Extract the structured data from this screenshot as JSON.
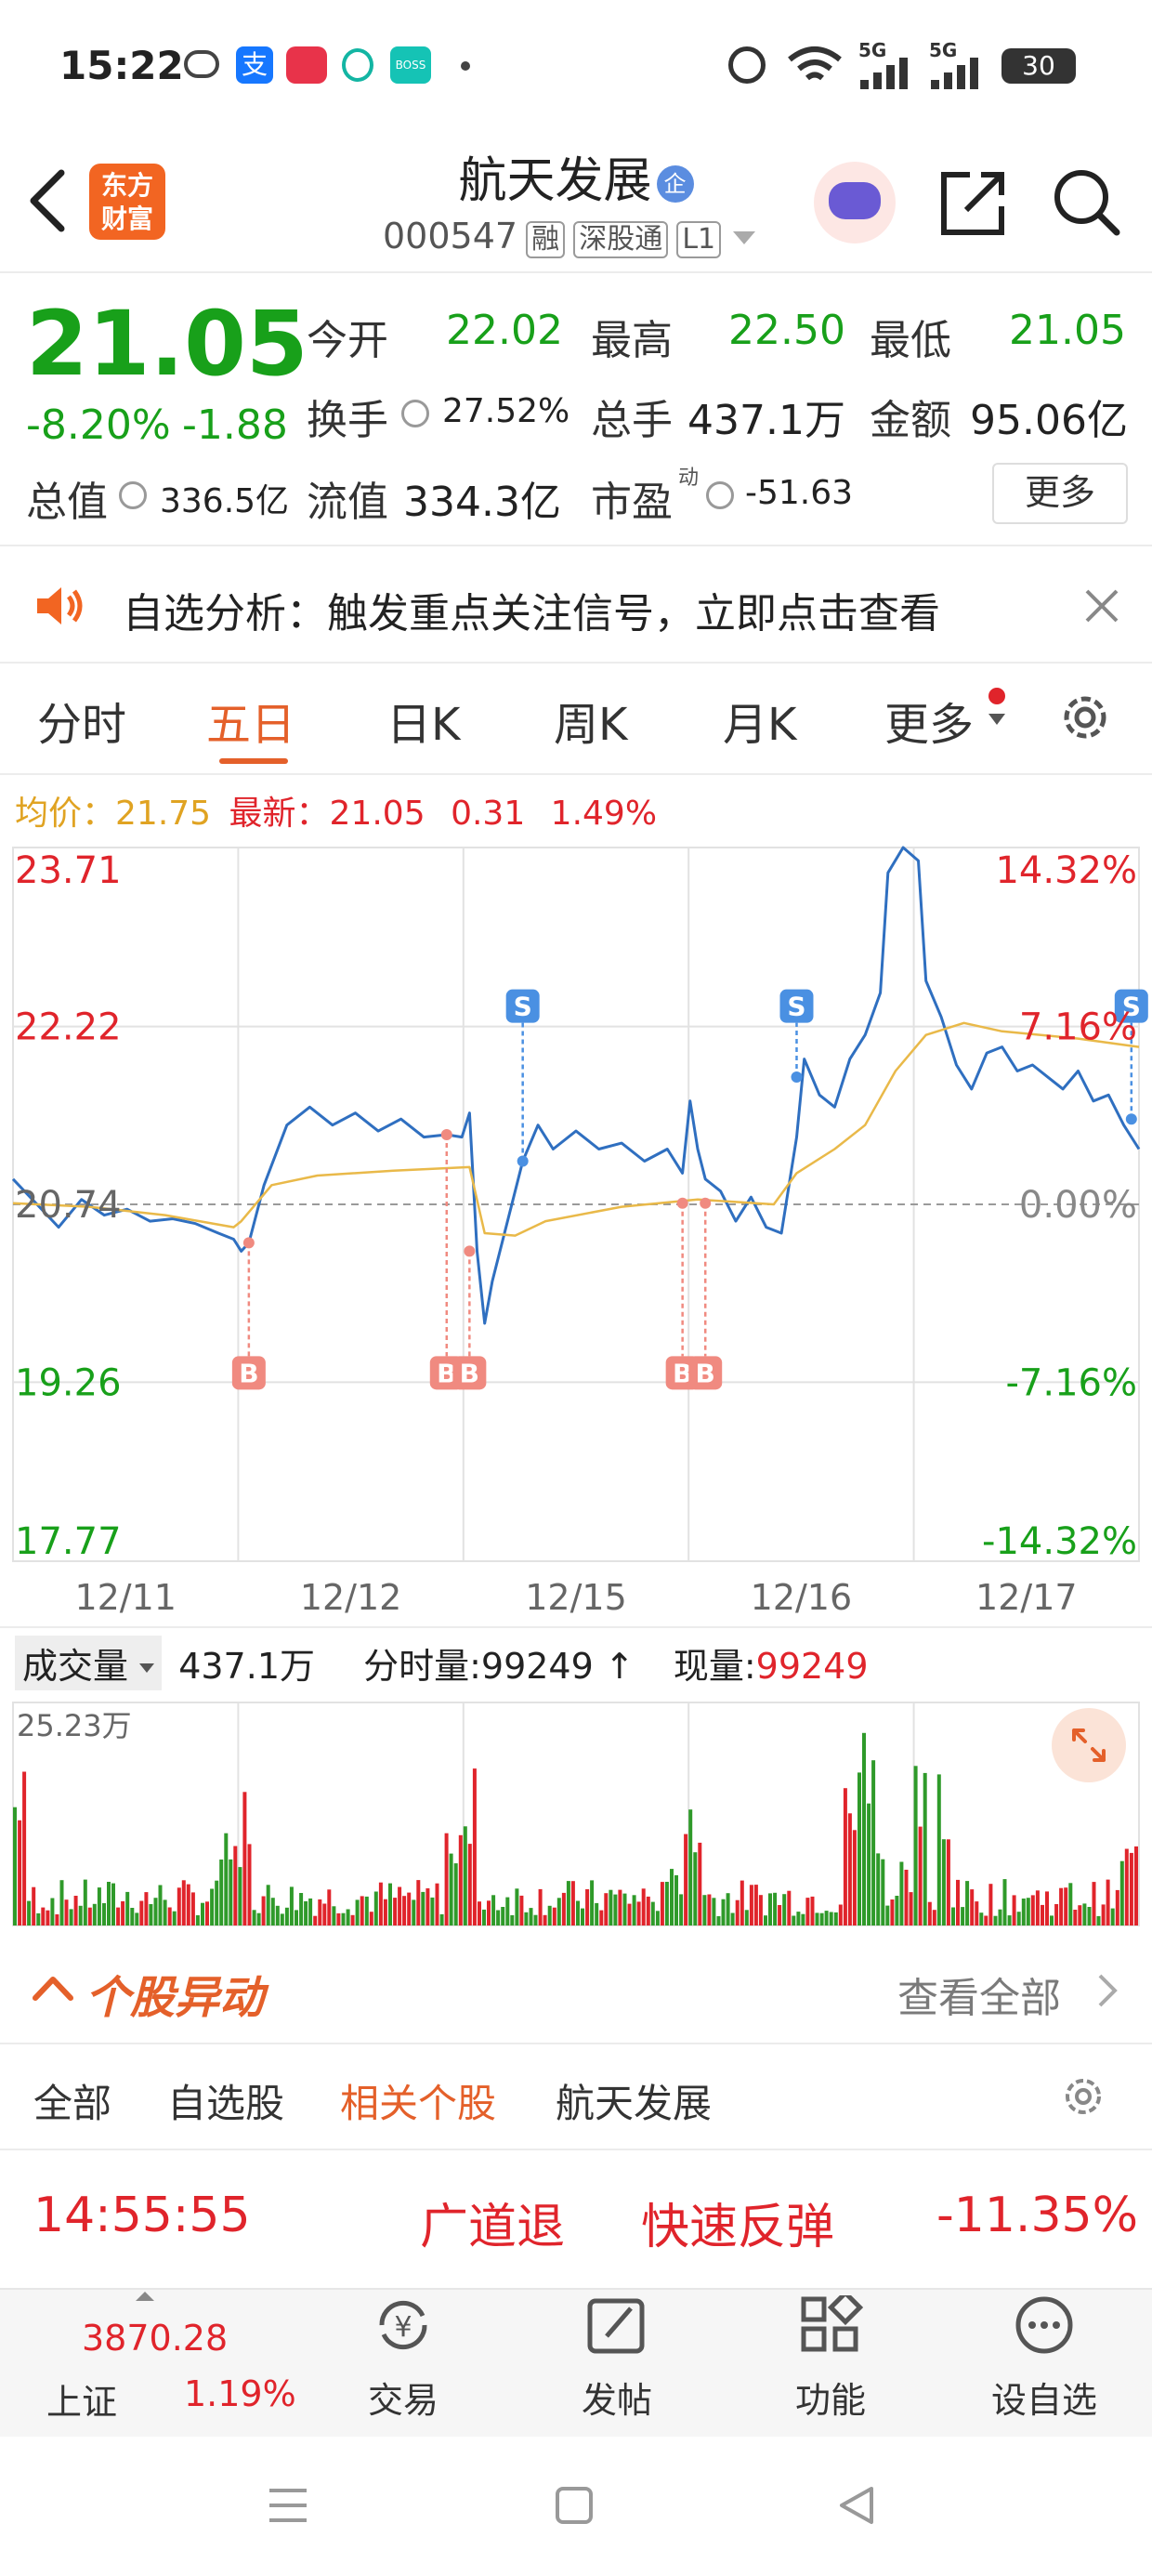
{
  "status_bar": {
    "time": "15:22",
    "battery": "30",
    "signal1": "5G",
    "signal2": "5G"
  },
  "header": {
    "logo_line1": "东方",
    "logo_line2": "财富",
    "stock_name": "航天发展",
    "badge": "企",
    "stock_code": "000547",
    "tags": [
      "融",
      "深股通",
      "L1"
    ]
  },
  "quote": {
    "price": "21.05",
    "change_pct": "-8.20%",
    "change": "-1.88",
    "stats": {
      "open_label": "今开",
      "open": "22.02",
      "high_label": "最高",
      "high": "22.50",
      "low_label": "最低",
      "low": "21.05",
      "turnover_label": "换手",
      "turnover": "27.52%",
      "volume_label": "总手",
      "volume": "437.1万",
      "amount_label": "金额",
      "amount": "95.06亿",
      "mktcap_label": "总值",
      "mktcap": "336.5亿",
      "float_label": "流值",
      "float": "334.3亿",
      "pe_label": "市盈",
      "pe_sup": "动",
      "pe": "-51.63"
    },
    "more_button": "更多"
  },
  "banner": {
    "text": "自选分析：触发重点关注信号，立即点击查看"
  },
  "tabs": {
    "items": [
      "分时",
      "五日",
      "日K",
      "周K",
      "月K",
      "更多"
    ],
    "active_index": 1
  },
  "chart_info": {
    "avg_label": "均价：",
    "avg_value": "21.75",
    "latest_label": "最新：",
    "latest_value": "21.05",
    "latest_change": "0.31",
    "latest_pct": "1.49%"
  },
  "chart_data": {
    "type": "line",
    "y_left_ticks": [
      "23.71",
      "22.22",
      "20.74",
      "19.26",
      "17.77"
    ],
    "y_right_ticks": [
      "14.32%",
      "7.16%",
      "0.00%",
      "-7.16%",
      "-14.32%"
    ],
    "x_labels": [
      "12/11",
      "12/12",
      "12/15",
      "12/16",
      "12/17"
    ],
    "ylim": [
      17.77,
      23.71
    ],
    "reference": 20.74,
    "series": [
      {
        "kind": "price",
        "color": "#2f6fc0",
        "points": [
          [
            0,
            20.95
          ],
          [
            3,
            20.75
          ],
          [
            6,
            20.55
          ],
          [
            9,
            20.78
          ],
          [
            12,
            20.65
          ],
          [
            15,
            20.7
          ],
          [
            18,
            20.6
          ],
          [
            21,
            20.62
          ],
          [
            24,
            20.58
          ],
          [
            27,
            20.5
          ],
          [
            29,
            20.45
          ],
          [
            30,
            20.35
          ],
          [
            31,
            20.42
          ],
          [
            33,
            20.9
          ],
          [
            36,
            21.4
          ],
          [
            39,
            21.55
          ],
          [
            42,
            21.4
          ],
          [
            45,
            21.5
          ],
          [
            48,
            21.35
          ],
          [
            51,
            21.45
          ],
          [
            54,
            21.3
          ],
          [
            57,
            21.32
          ],
          [
            59,
            21.3
          ],
          [
            60,
            21.5
          ],
          [
            61,
            20.35
          ],
          [
            62,
            19.75
          ],
          [
            63,
            20.1
          ],
          [
            65,
            20.6
          ],
          [
            67,
            21.1
          ],
          [
            69,
            21.4
          ],
          [
            71,
            21.2
          ],
          [
            74,
            21.35
          ],
          [
            77,
            21.2
          ],
          [
            80,
            21.25
          ],
          [
            83,
            21.1
          ],
          [
            86,
            21.2
          ],
          [
            88,
            21.0
          ],
          [
            89,
            21.6
          ],
          [
            90,
            21.2
          ],
          [
            91,
            20.95
          ],
          [
            93,
            20.85
          ],
          [
            95,
            20.6
          ],
          [
            97,
            20.8
          ],
          [
            99,
            20.55
          ],
          [
            101,
            20.5
          ],
          [
            103,
            21.3
          ],
          [
            104,
            21.95
          ],
          [
            106,
            21.65
          ],
          [
            108,
            21.55
          ],
          [
            110,
            21.95
          ],
          [
            112,
            22.15
          ],
          [
            114,
            22.5
          ],
          [
            115,
            23.5
          ],
          [
            117,
            23.71
          ],
          [
            119,
            23.6
          ],
          [
            120,
            22.6
          ],
          [
            122,
            22.3
          ],
          [
            124,
            21.9
          ],
          [
            126,
            21.7
          ],
          [
            128,
            22.0
          ],
          [
            130,
            22.05
          ],
          [
            132,
            21.85
          ],
          [
            134,
            21.9
          ],
          [
            136,
            21.8
          ],
          [
            138,
            21.7
          ],
          [
            140,
            21.85
          ],
          [
            142,
            21.6
          ],
          [
            144,
            21.65
          ],
          [
            146,
            21.4
          ],
          [
            148,
            21.2
          ]
        ]
      },
      {
        "kind": "average",
        "color": "#e9b949",
        "points": [
          [
            0,
            20.75
          ],
          [
            10,
            20.72
          ],
          [
            20,
            20.65
          ],
          [
            29,
            20.55
          ],
          [
            30,
            20.6
          ],
          [
            34,
            20.9
          ],
          [
            40,
            20.98
          ],
          [
            50,
            21.02
          ],
          [
            60,
            21.05
          ],
          [
            62,
            20.5
          ],
          [
            66,
            20.48
          ],
          [
            70,
            20.6
          ],
          [
            80,
            20.72
          ],
          [
            90,
            20.78
          ],
          [
            95,
            20.76
          ],
          [
            100,
            20.74
          ],
          [
            103,
            21.0
          ],
          [
            108,
            21.2
          ],
          [
            112,
            21.4
          ],
          [
            116,
            21.85
          ],
          [
            120,
            22.15
          ],
          [
            125,
            22.25
          ],
          [
            130,
            22.18
          ],
          [
            140,
            22.12
          ],
          [
            148,
            22.05
          ]
        ]
      }
    ],
    "markers": [
      {
        "label": "B",
        "x": 31,
        "price": 20.42,
        "side": "buy"
      },
      {
        "label": "B",
        "x": 57,
        "price": 21.32,
        "side": "buy"
      },
      {
        "label": "B",
        "x": 60,
        "price": 20.35,
        "side": "buy"
      },
      {
        "label": "S",
        "x": 67,
        "price": 21.1,
        "side": "sell"
      },
      {
        "label": "B",
        "x": 88,
        "price": 20.75,
        "side": "buy"
      },
      {
        "label": "B",
        "x": 91,
        "price": 20.75,
        "side": "buy"
      },
      {
        "label": "S",
        "x": 103,
        "price": 21.8,
        "side": "sell"
      },
      {
        "label": "S",
        "x": 147,
        "price": 21.45,
        "side": "sell"
      }
    ],
    "x_max": 148
  },
  "volume": {
    "selector_label": "成交量",
    "total": "437.1万",
    "minute_label": "分时量:",
    "minute_value": "99249",
    "current_label": "现量:",
    "current_value": "99249",
    "max_label": "25.23万"
  },
  "movers": {
    "title": "个股异动",
    "view_all": "查看全部",
    "filters": [
      "全部",
      "自选股",
      "相关个股",
      "航天发展"
    ],
    "active_filter_index": 2,
    "item": {
      "time": "14:55:55",
      "name": "广道退",
      "event": "快速反弹",
      "pct": "-11.35%"
    }
  },
  "bottom_nav": {
    "index_value": "3870.28",
    "index_name": "上证",
    "index_pct": "1.19%",
    "items": [
      "交易",
      "发帖",
      "功能",
      "设自选"
    ]
  },
  "colors": {
    "accent": "#e4602a",
    "up": "#e0242b",
    "down": "#18a01a",
    "price_line": "#2f6fc0",
    "avg_line": "#e9b949"
  }
}
